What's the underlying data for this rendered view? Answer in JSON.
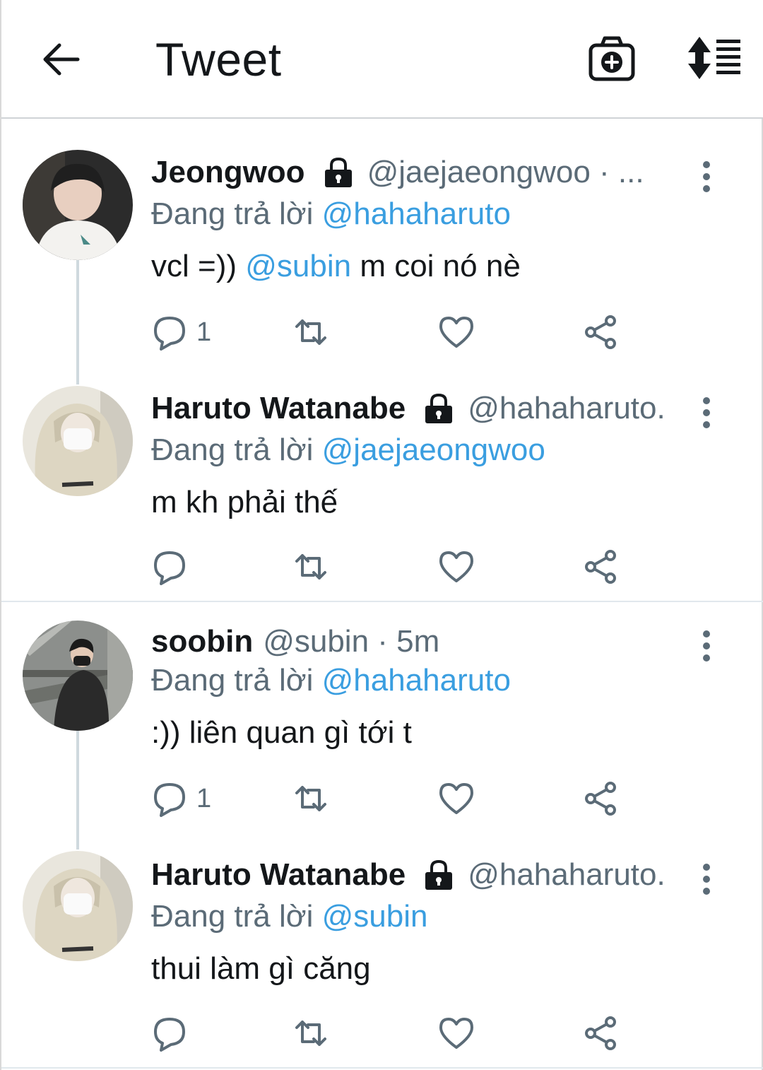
{
  "header": {
    "title": "Tweet",
    "back_icon": "arrow-left-icon",
    "camera_icon": "camera-plus-icon",
    "sort_icon": "sort-replies-icon"
  },
  "colors": {
    "mention": "#3a9ee0",
    "secondary_text": "#5b6b77",
    "thread_line": "#cfd9de"
  },
  "tweets": [
    {
      "name": "Jeongwoo",
      "locked": true,
      "handle_meta": "@jaejaeongwoo · ...",
      "reply_prefix": "Đang trả lời",
      "reply_to": "@hahaharuto",
      "text_before": "vcl =))",
      "text_mention": "@subin",
      "text_after": "m coi nó nè",
      "reply_count": "1"
    },
    {
      "name": "Haruto Watanabe",
      "locked": true,
      "handle_meta": "@hahaharuto.",
      "reply_prefix": "Đang trả lời",
      "reply_to": "@jaejaeongwoo",
      "text": "m kh phải thế",
      "reply_count": ""
    },
    {
      "name": "soobin",
      "locked": false,
      "handle_meta": "@subin · 5m",
      "reply_prefix": "Đang trả lời",
      "reply_to": "@hahaharuto",
      "text": ":)) liên quan gì tới t",
      "reply_count": "1"
    },
    {
      "name": "Haruto Watanabe",
      "locked": true,
      "handle_meta": "@hahaharuto.",
      "reply_prefix": "Đang trả lời",
      "reply_to": "@subin",
      "text": "thui làm gì căng",
      "reply_count": ""
    }
  ]
}
